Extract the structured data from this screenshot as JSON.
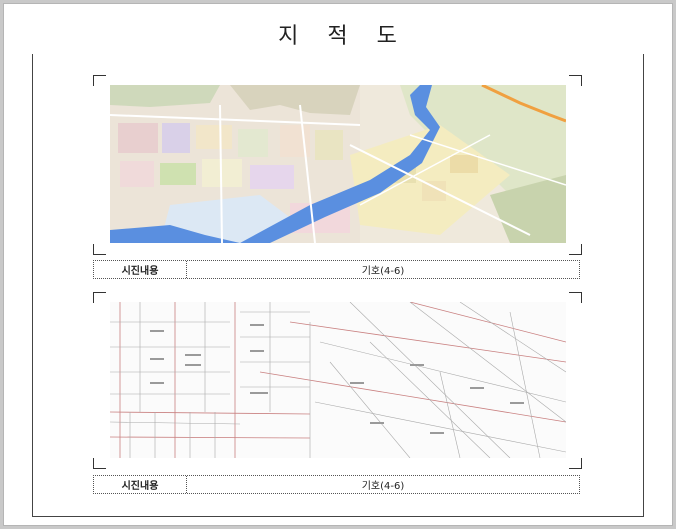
{
  "document": {
    "title": "지 적 도"
  },
  "panels": [
    {
      "image": "aerial-land-use-map",
      "caption_label": "시진내용",
      "caption_value": "기호(4-6)"
    },
    {
      "image": "cadastral-parcel-map",
      "caption_label": "시진내용",
      "caption_value": "기호(4-6)"
    }
  ],
  "colors": {
    "river": "#5a8fe0",
    "highway": "#f0a040",
    "green_area": "#cfe1b0",
    "parcel_line": "#c98080"
  }
}
